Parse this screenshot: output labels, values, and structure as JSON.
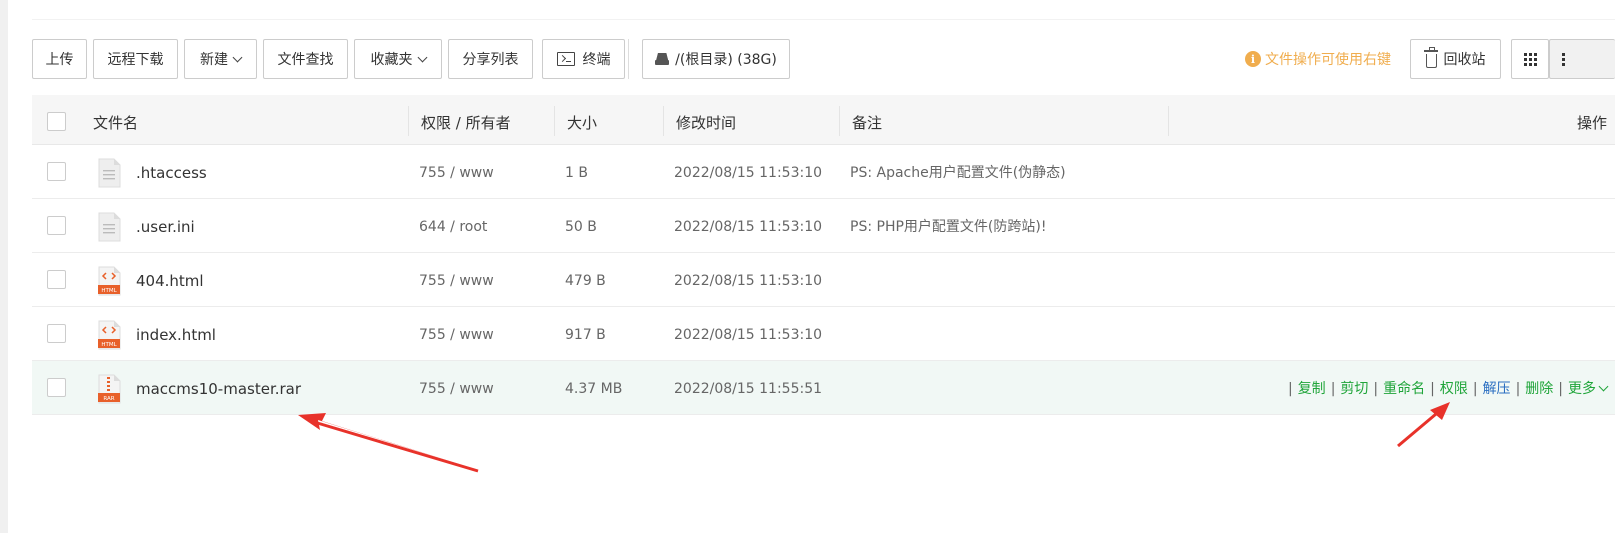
{
  "toolbar": {
    "upload": "上传",
    "remote_download": "远程下载",
    "new": "新建",
    "file_search": "文件查找",
    "favorites": "收藏夹",
    "share_list": "分享列表",
    "terminal": "终端",
    "path": "/(根目录) (38G)",
    "hint": "文件操作可使用右键",
    "recycle_bin": "回收站"
  },
  "table": {
    "headers": {
      "name": "文件名",
      "perm": "权限 / 所有者",
      "size": "大小",
      "mtime": "修改时间",
      "note": "备注",
      "ops": "操作"
    },
    "rows": [
      {
        "name": ".htaccess",
        "perm": "755 / www",
        "size": "1 B",
        "mtime": "2022/08/15 11:53:10",
        "note": "PS: Apache用户配置文件(伪静态)",
        "icon": "text-file-icon"
      },
      {
        "name": ".user.ini",
        "perm": "644 / root",
        "size": "50 B",
        "mtime": "2022/08/15 11:53:10",
        "note": "PS: PHP用户配置文件(防跨站)!",
        "icon": "text-file-icon"
      },
      {
        "name": "404.html",
        "perm": "755 / www",
        "size": "479 B",
        "mtime": "2022/08/15 11:53:10",
        "note": "",
        "icon": "html-file-icon"
      },
      {
        "name": "index.html",
        "perm": "755 / www",
        "size": "917 B",
        "mtime": "2022/08/15 11:53:10",
        "note": "",
        "icon": "html-file-icon"
      },
      {
        "name": "maccms10-master.rar",
        "perm": "755 / www",
        "size": "4.37 MB",
        "mtime": "2022/08/15 11:55:51",
        "note": "",
        "icon": "rar-file-icon"
      }
    ],
    "row_ops": {
      "copy": "复制",
      "cut": "剪切",
      "rename": "重命名",
      "perm": "权限",
      "extract": "解压",
      "delete": "删除",
      "more": "更多"
    }
  },
  "icon_labels": {
    "html": "HTML",
    "rar": "RAR"
  },
  "colors": {
    "accent_green": "#20a53a",
    "warning_orange": "#f0ad4e",
    "highlight_row": "#f1f8f5",
    "extract_blue": "#2a6ec1",
    "annotation_red": "#e8322a"
  }
}
